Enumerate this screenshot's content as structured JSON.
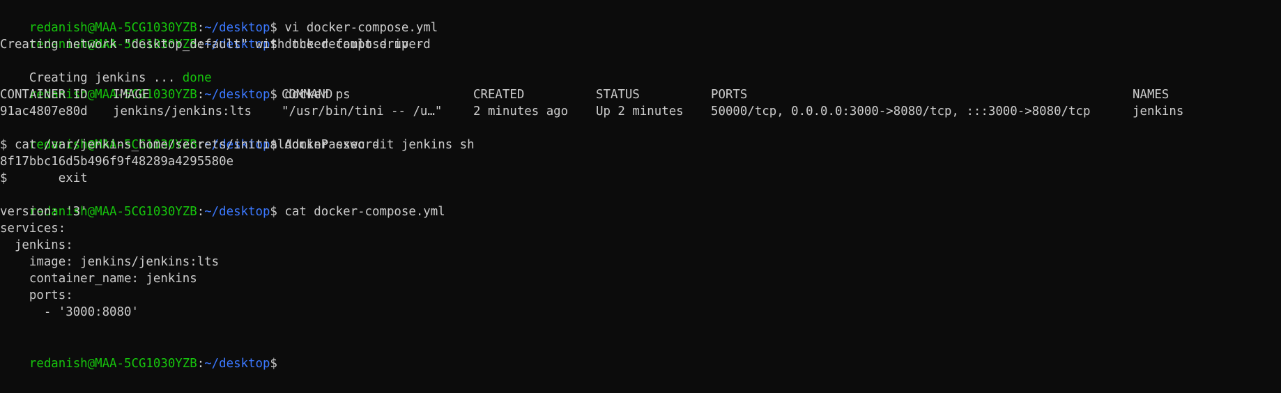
{
  "prompt": {
    "user": "redanish@MAA-5CG1030YZB",
    "separator": ":",
    "path": "~/desktop",
    "symbol": "$"
  },
  "lines": {
    "cmd_vi": " vi docker-compose.yml",
    "cmd_up": " docker-compose up -d",
    "out_network": "Creating network \"desktop_default\" with the default driver",
    "out_jenkins_prefix": "Creating jenkins ... ",
    "out_jenkins_done": "done",
    "cmd_ps": " docker ps",
    "cmd_exec": " docker exec -it jenkins sh",
    "sh_cat": "$ cat /var/jenkins_home/secrets/initialAdminPassword",
    "sh_password": "8f17bbc16d5b496f9f48289a4295580e",
    "sh_exit": "$       exit",
    "cmd_cat": " cat docker-compose.yml",
    "yaml": [
      "version: '3'",
      "services:",
      "  jenkins:",
      "    image: jenkins/jenkins:lts",
      "    container_name: jenkins",
      "    ports:",
      "      - '3000:8080'"
    ]
  },
  "docker_ps": {
    "headers": [
      "CONTAINER ID",
      "IMAGE",
      "COMMAND",
      "CREATED",
      "STATUS",
      "PORTS",
      "NAMES"
    ],
    "row": [
      "91ac4807e80d",
      "jenkins/jenkins:lts",
      "\"/usr/bin/tini -- /u…\"",
      "2 minutes ago",
      "Up 2 minutes",
      "50000/tcp, 0.0.0.0:3000->8080/tcp, :::3000->8080/tcp",
      "jenkins"
    ]
  }
}
